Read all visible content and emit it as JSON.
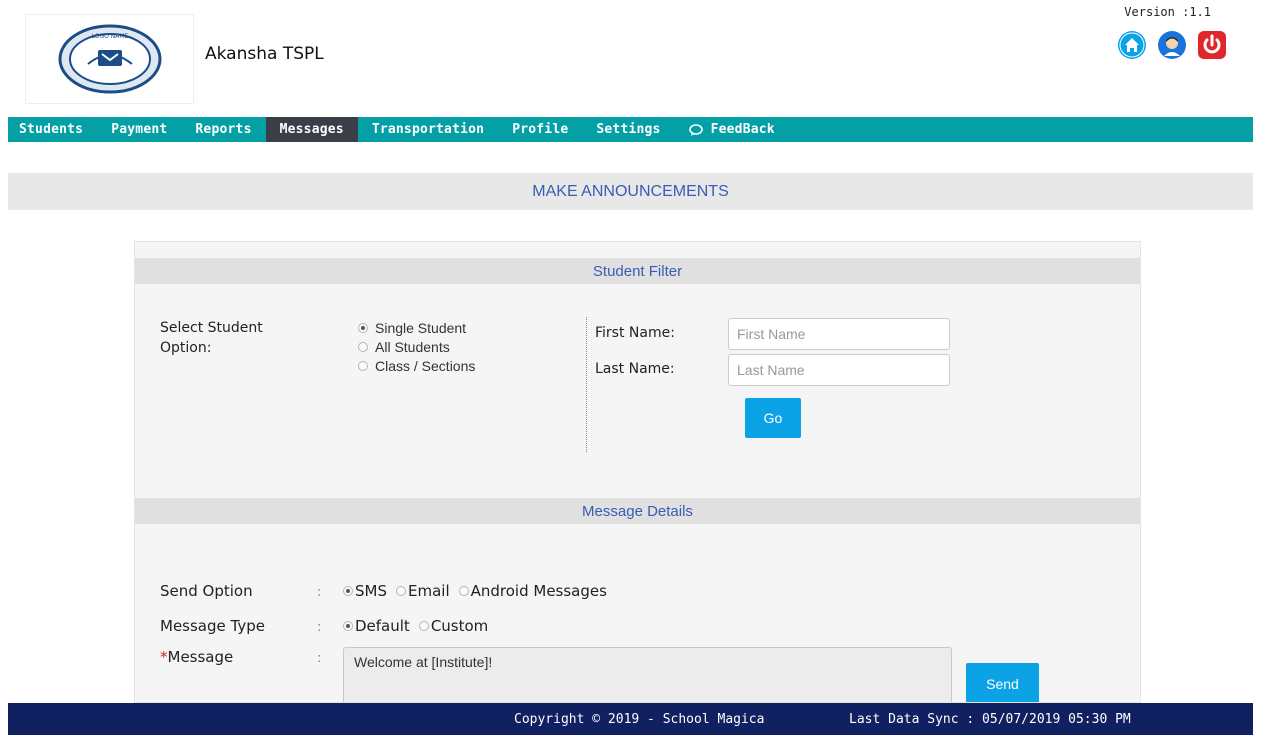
{
  "header": {
    "app_name": "Akansha TSPL",
    "version": "Version :1.1",
    "logo_text": "LOGO NAME",
    "icons": [
      "home-icon",
      "user-icon",
      "power-icon"
    ],
    "colors": {
      "home": "#0ba3e6",
      "user": "#1a73d9",
      "power": "#e0262b"
    }
  },
  "nav": {
    "items": [
      {
        "label": "Students"
      },
      {
        "label": "Payment"
      },
      {
        "label": "Reports"
      },
      {
        "label": "Messages",
        "active": true
      },
      {
        "label": "Transportation"
      },
      {
        "label": "Profile"
      },
      {
        "label": "Settings"
      },
      {
        "label": "FeedBack",
        "icon": "chat-icon"
      }
    ],
    "color": "#05a0a5"
  },
  "page_title": "MAKE ANNOUNCEMENTS",
  "student_filter": {
    "heading": "Student Filter",
    "select_label": "Select Student Option:",
    "options": [
      {
        "label": "Single Student",
        "checked": true
      },
      {
        "label": "All Students",
        "checked": false
      },
      {
        "label": "Class / Sections",
        "checked": false
      }
    ],
    "first_name_label": "First Name:",
    "first_name_placeholder": "First Name",
    "first_name_value": "",
    "last_name_label": "Last Name:",
    "last_name_placeholder": "Last Name",
    "last_name_value": "",
    "go_label": "Go"
  },
  "message_details": {
    "heading": "Message Details",
    "send_option_label": "Send Option",
    "send_options": [
      {
        "label": "SMS",
        "checked": true
      },
      {
        "label": "Email",
        "checked": false
      },
      {
        "label": "Android Messages",
        "checked": false
      }
    ],
    "message_type_label": "Message Type",
    "message_types": [
      {
        "label": "Default",
        "checked": true
      },
      {
        "label": "Custom",
        "checked": false
      }
    ],
    "message_label": "Message",
    "required_mark": "*",
    "colon": ":",
    "message_value": "Welcome at [Institute]!",
    "send_label": "Send"
  },
  "footer": {
    "copyright": "Copyright © 2019 - School Magica",
    "last_sync": "Last Data Sync : 05/07/2019 05:30 PM",
    "color": "#102060"
  }
}
